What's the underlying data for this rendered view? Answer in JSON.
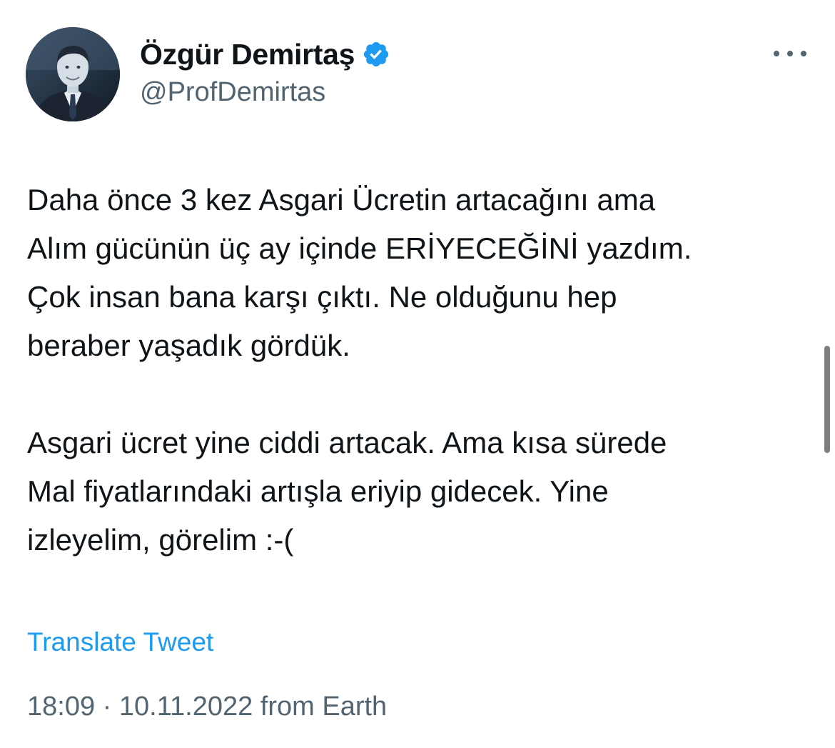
{
  "author": {
    "display_name": "Özgür Demirtaş",
    "handle": "@ProfDemirtas",
    "verified": true,
    "verified_icon": "verified-badge-icon",
    "verified_color": "#1d9bf0"
  },
  "menu": {
    "icon": "more-options-icon"
  },
  "tweet": {
    "paragraph_1": "Daha önce 3 kez Asgari Ücretin artacağını ama\nAlım gücünün üç ay içinde ERİYECEĞİNİ yazdım.\nÇok insan bana karşı çıktı. Ne olduğunu hep\nberaber yaşadık gördük.",
    "paragraph_2": "Asgari ücret yine ciddi artacak. Ama kısa sürede\nMal fiyatlarındaki artışla eriyip gidecek. Yine\nizleyelim, görelim :-("
  },
  "translate_label": "Translate Tweet",
  "meta": {
    "text": "18:09 · 10.11.2022 from Earth"
  },
  "colors": {
    "text": "#0f1419",
    "secondary": "#536471",
    "link": "#1d9bf0"
  }
}
